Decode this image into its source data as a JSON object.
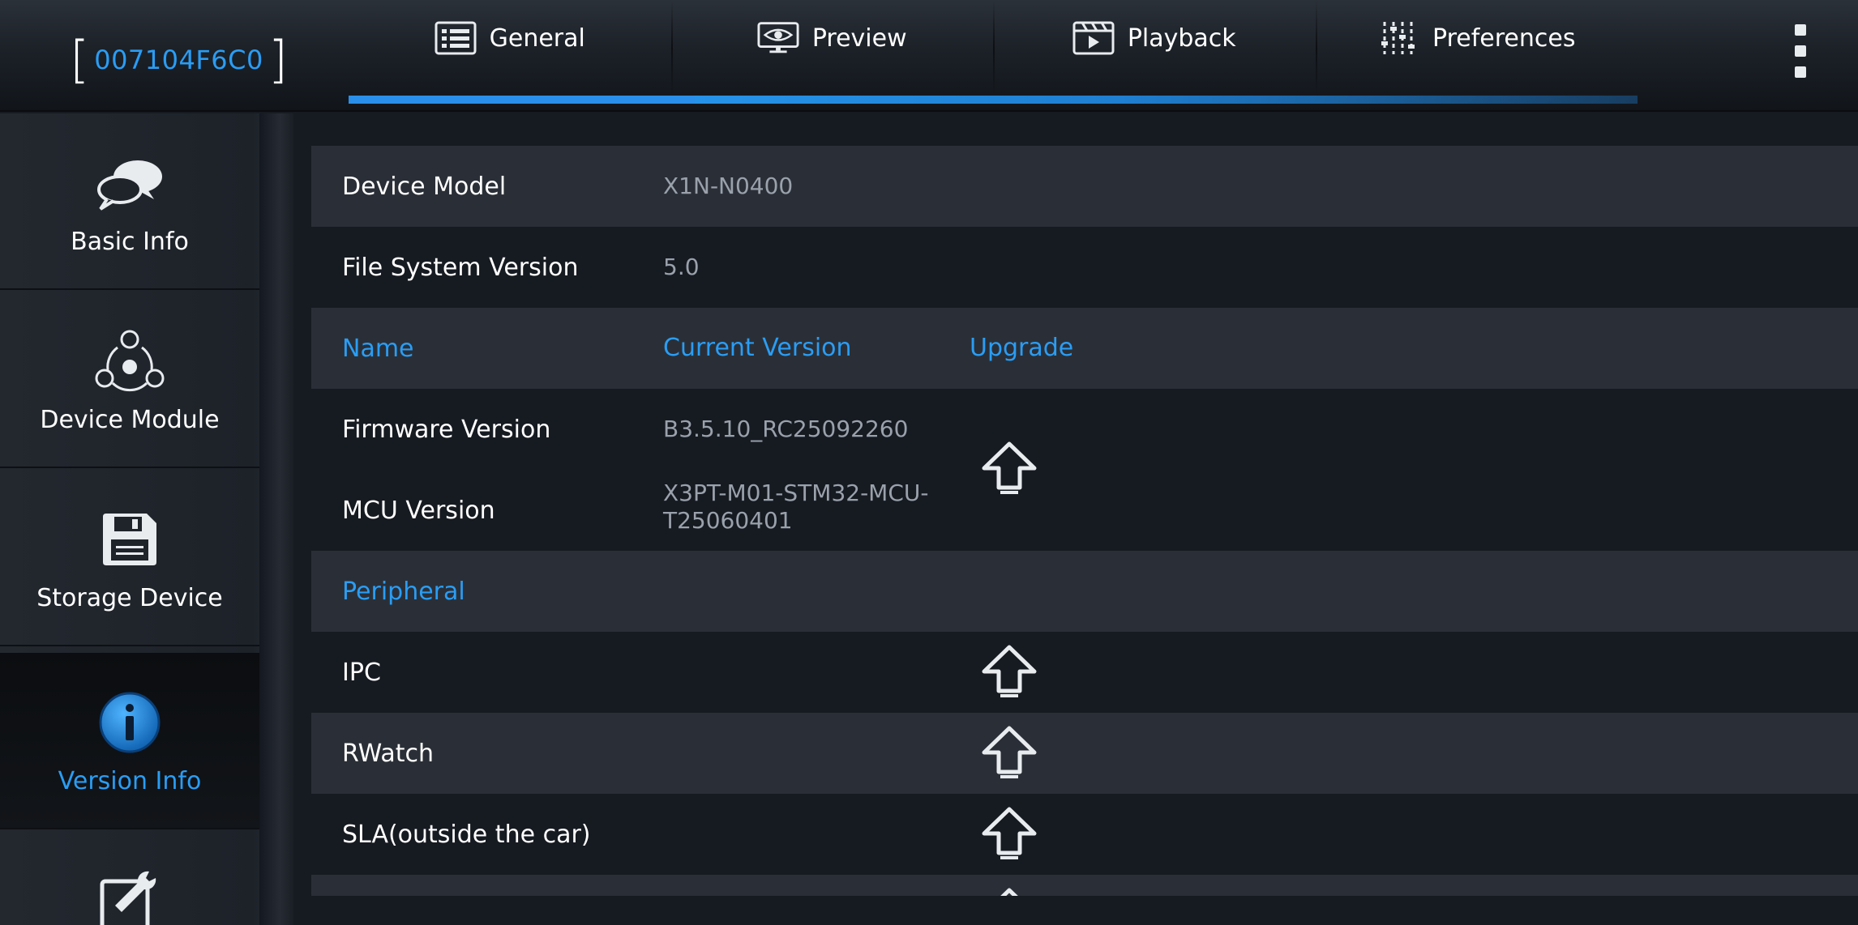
{
  "header": {
    "device_id": "007104F6C0",
    "tabs": [
      {
        "label": "General",
        "icon": "grid-panel-icon",
        "active": true
      },
      {
        "label": "Preview",
        "icon": "eye-monitor-icon",
        "active": false
      },
      {
        "label": "Playback",
        "icon": "film-play-icon",
        "active": false
      },
      {
        "label": "Preferences",
        "icon": "sliders-icon",
        "active": false
      }
    ],
    "more_icon": "kebab-menu-icon"
  },
  "sidebar": {
    "items": [
      {
        "label": "Basic Info",
        "icon": "chat-bubbles-icon",
        "active": false
      },
      {
        "label": "Device Module",
        "icon": "module-network-icon",
        "active": false
      },
      {
        "label": "Storage Device",
        "icon": "floppy-disk-icon",
        "active": false
      },
      {
        "label": "Version Info",
        "icon": "info-circle-icon",
        "active": true
      },
      {
        "label": "",
        "icon": "wrench-tool-icon",
        "active": false
      }
    ]
  },
  "table": {
    "device_model": {
      "name": "Device Model",
      "value": "X1N-N0400"
    },
    "fs_version": {
      "name": "File System Version",
      "value": "5.0"
    },
    "columns": {
      "name": "Name",
      "current": "Current Version",
      "upgrade": "Upgrade"
    },
    "firmware": {
      "name": "Firmware Version",
      "value": "B3.5.10_RC25092260"
    },
    "mcu": {
      "name": "MCU Version",
      "value_line1": "X3PT-M01-STM32-MCU-",
      "value_line2": "T25060401"
    },
    "peripheral_header": "Peripheral",
    "peripherals": [
      {
        "name": "IPC"
      },
      {
        "name": "RWatch"
      },
      {
        "name": "SLA(outside the car)"
      }
    ]
  },
  "colors": {
    "accent": "#2a9df4",
    "text": "#ffffff",
    "muted": "#9aa1ab",
    "row_light": "#2a2f37",
    "row_dark": "#161a21"
  }
}
